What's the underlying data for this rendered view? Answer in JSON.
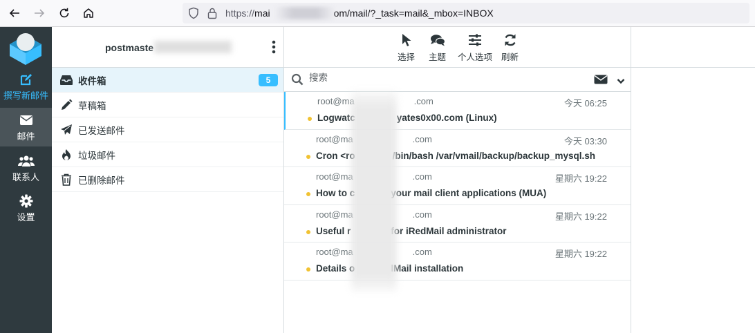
{
  "browser": {
    "url_prefix": "https://",
    "url_host": "mai",
    "url_rest": "om/mail/?_task=mail&_mbox=INBOX"
  },
  "nav": {
    "compose_label": "撰写新邮件",
    "mail_label": "邮件",
    "contacts_label": "联系人",
    "settings_label": "设置"
  },
  "account": {
    "name": "postmaste"
  },
  "folders": [
    {
      "name": "收件箱",
      "unread": "5",
      "icon": "inbox-icon"
    },
    {
      "name": "草稿箱",
      "icon": "pencil-icon"
    },
    {
      "name": "已发送邮件",
      "icon": "paper-plane-icon"
    },
    {
      "name": "垃圾邮件",
      "icon": "fire-icon"
    },
    {
      "name": "已删除邮件",
      "icon": "trash-icon"
    }
  ],
  "toolbar": {
    "select_label": "选择",
    "threads_label": "主题",
    "options_label": "个人选项",
    "refresh_label": "刷新"
  },
  "search": {
    "placeholder": "搜索"
  },
  "messages": [
    {
      "from": "root@ma",
      "from_tail": ".com",
      "date": "今天 06:25",
      "subject_a": "Logwatc",
      "subject_b": "yates0x00.com (Linux)"
    },
    {
      "from": "root@ma",
      "from_tail": ".com",
      "date": "今天 03:30",
      "subject_a": "Cron <ro",
      "subject_b": "/bin/bash /var/vmail/backup/backup_mysql.sh"
    },
    {
      "from": "root@ma",
      "from_tail": ".com",
      "date": "星期六 19:22",
      "subject_a": "How to c",
      "subject_b": "your mail client applications (MUA)"
    },
    {
      "from": "root@ma",
      "from_tail": ".com",
      "date": "星期六 19:22",
      "subject_a": "Useful r",
      "subject_b": "for iRedMail administrator"
    },
    {
      "from": "root@ma",
      "from_tail": ".com",
      "date": "星期六 19:22",
      "subject_a": "Details o",
      "subject_b": "lMail installation"
    }
  ],
  "colors": {
    "accent": "#37beff",
    "sidebar": "#2f3a3f",
    "unread_dot": "#f1c232"
  }
}
